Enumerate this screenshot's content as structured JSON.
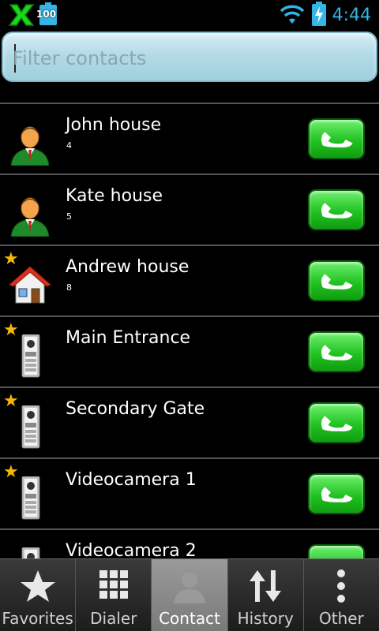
{
  "status_bar": {
    "battery_level": "100",
    "time": "4:44"
  },
  "filter": {
    "placeholder": "Filter contacts"
  },
  "contacts": [
    {
      "name": "John house",
      "number": "4",
      "icon": "person-icon",
      "favorite": false
    },
    {
      "name": "Kate house",
      "number": "5",
      "icon": "person-icon",
      "favorite": false
    },
    {
      "name": "Andrew house",
      "number": "8",
      "icon": "house-icon",
      "favorite": true
    },
    {
      "name": "Main Entrance",
      "number": "",
      "icon": "intercom-icon",
      "favorite": true
    },
    {
      "name": "Secondary Gate",
      "number": "",
      "icon": "intercom-icon",
      "favorite": true
    },
    {
      "name": "Videocamera 1",
      "number": "",
      "icon": "intercom-icon",
      "favorite": true
    },
    {
      "name": "Videocamera 2",
      "number": "",
      "icon": "intercom-icon",
      "favorite": false
    }
  ],
  "tabs": [
    {
      "label": "Favorites",
      "icon": "star-icon",
      "active": false
    },
    {
      "label": "Dialer",
      "icon": "keypad-icon",
      "active": false
    },
    {
      "label": "Contact",
      "icon": "contact-icon",
      "active": true
    },
    {
      "label": "History",
      "icon": "history-icon",
      "active": false
    },
    {
      "label": "Other",
      "icon": "more-icon",
      "active": false
    }
  ],
  "colors": {
    "accent": "#33b5e5",
    "call_button": "#22c222",
    "favorite_star": "#f5b700"
  }
}
